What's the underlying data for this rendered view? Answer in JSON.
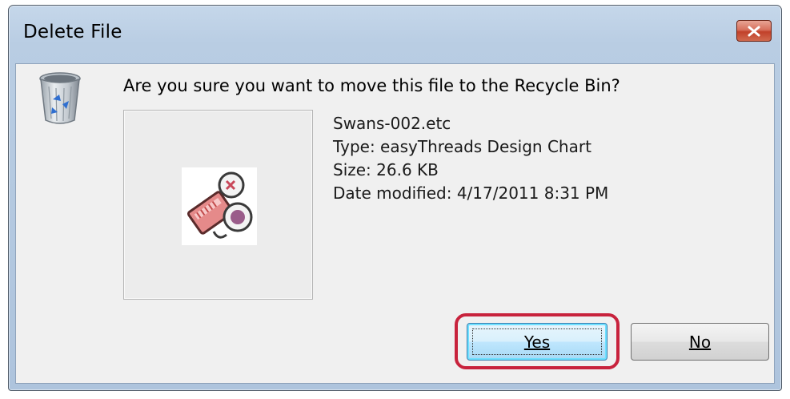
{
  "window": {
    "title": "Delete File",
    "close_icon": "close-icon"
  },
  "dialog": {
    "icon": "recycle-bin-icon",
    "question": "Are you sure you want to move this file to the Recycle Bin?",
    "file": {
      "thumbnail_icon": "easythreads-file-icon",
      "name": "Swans-002.etc",
      "type": "Type: easyThreads Design Chart",
      "size": "Size: 26.6 KB",
      "date_modified": "Date modified: 4/17/2011 8:31 PM"
    }
  },
  "buttons": {
    "yes_label": "Yes",
    "no_label": "No",
    "highlight_color": "#c8233d"
  }
}
